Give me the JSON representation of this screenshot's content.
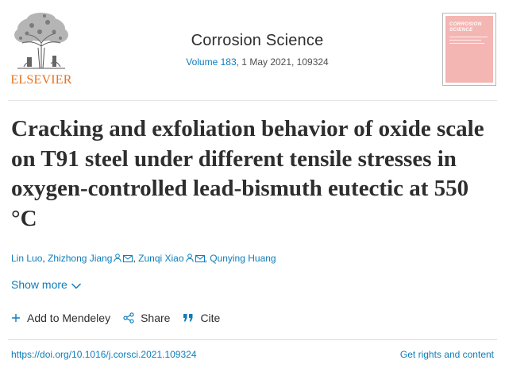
{
  "header": {
    "logo_text": "ELSEVIER",
    "journal_title": "Corrosion Science",
    "volume_link": "Volume 183",
    "volume_rest": ", 1 May 2021, 109324",
    "cover_text": "CORROSION SCIENCE"
  },
  "article": {
    "title": "Cracking and exfoliation behavior of oxide scale on T91 steel under different tensile stresses in oxygen-controlled lead-bismuth eutectic at 550 °C",
    "authors": [
      {
        "name": "Lin Luo",
        "icons": false
      },
      {
        "name": "Zhizhong Jiang",
        "icons": true
      },
      {
        "name": "Zunqi Xiao",
        "icons": true
      },
      {
        "name": "Qunying Huang",
        "icons": false
      }
    ],
    "author_separator": ",",
    "show_more": "Show more"
  },
  "actions": {
    "mendeley": "Add to Mendeley",
    "share": "Share",
    "cite": "Cite"
  },
  "footer": {
    "doi": "https://doi.org/10.1016/j.corsci.2021.109324",
    "rights": "Get rights and content"
  },
  "colors": {
    "link": "#0c7dbb",
    "text": "#2e2e2e",
    "elsevier_orange": "#e9711c",
    "cover_pink": "#f4b6b3"
  }
}
